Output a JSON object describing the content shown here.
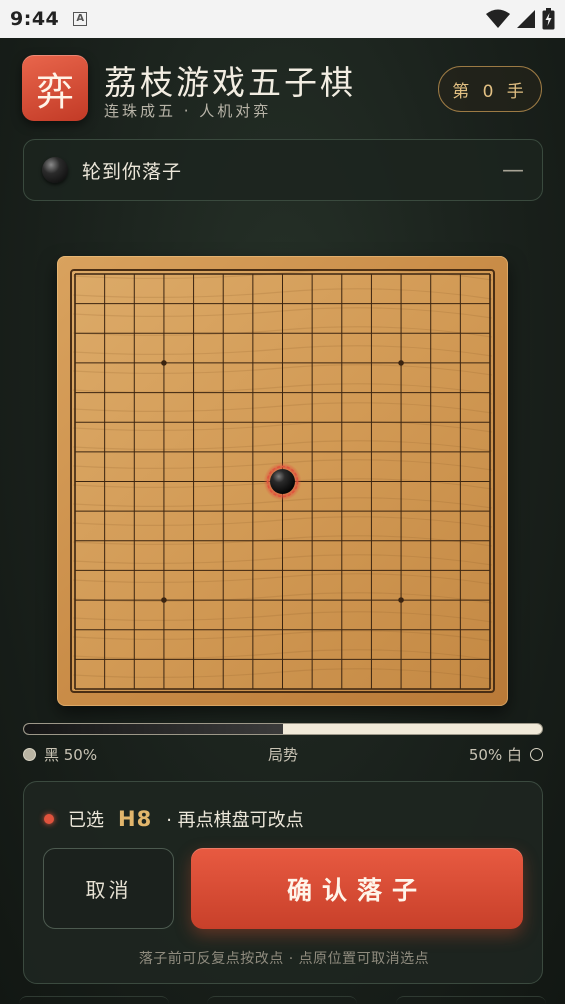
{
  "status_bar": {
    "time": "9:44",
    "app_icon_letter": "A",
    "icons": [
      "wifi-icon",
      "signal-icon",
      "battery-icon"
    ]
  },
  "header": {
    "logo_char": "弈",
    "title": "荔枝游戏五子棋",
    "subtitle": "连珠成五 · 人机对弈",
    "move_counter": "第 0 手"
  },
  "turn_banner": {
    "text": "轮到你落子",
    "collapse_symbol": "—"
  },
  "board": {
    "size": 15,
    "star_points": [
      [
        3,
        3
      ],
      [
        11,
        3
      ],
      [
        7,
        7
      ],
      [
        3,
        11
      ],
      [
        11,
        11
      ]
    ],
    "stones": [
      {
        "col": 7,
        "row": 7,
        "color": "black",
        "highlighted": true
      }
    ],
    "colors": {
      "wood": "#d4a05c",
      "line": "#3b2410",
      "frame": "#c98c47",
      "highlight": "#e0533d"
    }
  },
  "balance": {
    "black_label": "黑 50%",
    "center_label": "局势",
    "white_label": "50% 白",
    "black_fraction": 0.5
  },
  "confirm_panel": {
    "selected_prefix": "已选",
    "selected_coord": "H8",
    "selected_suffix": "· 再点棋盘可改点",
    "cancel_label": "取消",
    "confirm_label": "确认落子",
    "hint": "落子前可反复点按改点 · 点原位置可取消选点"
  },
  "colors": {
    "accent_red": "#e0533d",
    "accent_gold": "#e2b66c",
    "background": "#1a211c"
  }
}
